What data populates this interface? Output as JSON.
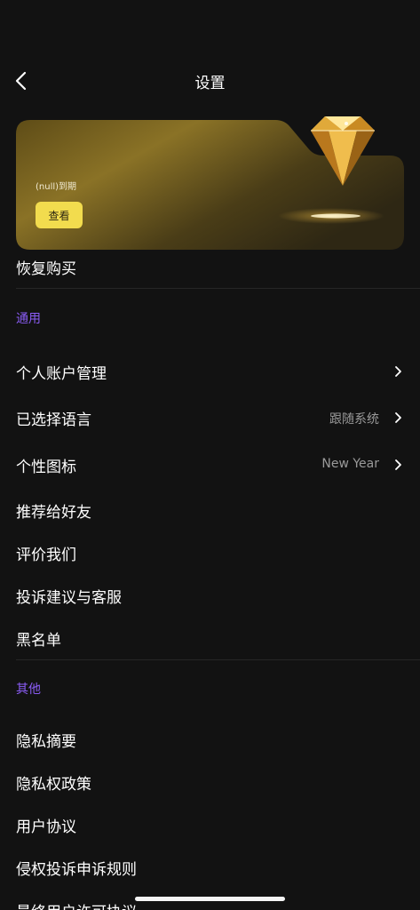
{
  "header": {
    "title": "设置",
    "back_icon": "chevron-left-icon"
  },
  "vip_card": {
    "expire_text": "(null)到期",
    "view_label": "查看",
    "accent_color": "#f2dc4e",
    "image": "gold-diamond"
  },
  "restore_label": "恢复购买",
  "general": {
    "heading": "通用",
    "items": [
      {
        "label": "个人账户管理",
        "value": "",
        "chevron": true
      },
      {
        "label": "已选择语言",
        "value": "跟随系统",
        "chevron": true
      },
      {
        "label": "个性图标",
        "value": "New Year",
        "chevron": true
      },
      {
        "label": "推荐给好友",
        "value": "",
        "chevron": false
      },
      {
        "label": "评价我们",
        "value": "",
        "chevron": false
      },
      {
        "label": "投诉建议与客服",
        "value": "",
        "chevron": false
      },
      {
        "label": "黑名单",
        "value": "",
        "chevron": false
      }
    ]
  },
  "other": {
    "heading": "其他",
    "items": [
      {
        "label": "隐私摘要"
      },
      {
        "label": "隐私权政策"
      },
      {
        "label": "用户协议"
      },
      {
        "label": "侵权投诉申诉规则"
      },
      {
        "label": "最终用户许可协议"
      }
    ]
  },
  "colors": {
    "background": "#121212",
    "section_heading": "#8a5cf5",
    "secondary_text": "#9a9a9a"
  }
}
